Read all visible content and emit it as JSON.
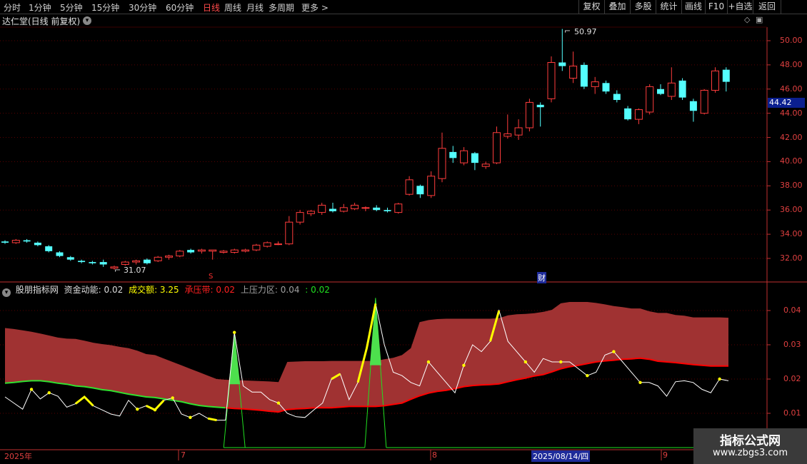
{
  "toolbar": {
    "left_items": [
      "分时",
      "1分钟",
      "5分钟",
      "15分钟",
      "30分钟",
      "60分钟",
      "日线",
      "周线",
      "月线",
      "多周期",
      "更多"
    ],
    "active_item": "日线",
    "right_items": [
      "复权",
      "叠加",
      "多股",
      "统计",
      "画线",
      "F10",
      "+自选",
      "返回"
    ],
    "more_arrow": ">"
  },
  "chart_header": {
    "title": "达仁堂(日线 前复权)"
  },
  "price_axis": {
    "ticks": [
      "50.00",
      "48.00",
      "46.00",
      "44.00",
      "42.00",
      "40.00",
      "38.00",
      "36.00",
      "34.00",
      "32.00"
    ],
    "current_price": "44.42"
  },
  "annotations": {
    "high_label": "50.97",
    "low_label": "31.07",
    "event_s": "S",
    "event_cai": "财"
  },
  "indicator": {
    "name": "股朋指标网",
    "fields": [
      {
        "label": "资金动能: 0.02",
        "color": "#dcdcdc"
      },
      {
        "label": "成交额: 3.25",
        "color": "#ffff00"
      },
      {
        "label": "承压带: 0.02",
        "color": "#ff2020"
      },
      {
        "label": "上压力区: 0.04",
        "color": "#a0a0a0"
      },
      {
        "label": ": 0.02",
        "color": "#20e020"
      }
    ],
    "axis_ticks": [
      "0.04",
      "0.03",
      "0.02",
      "0.01"
    ]
  },
  "date_axis": {
    "labels": [
      "2025年",
      "7",
      "8",
      "9"
    ],
    "cursor_date": "2025/08/14/四"
  },
  "watermark": {
    "title": "指标公式网",
    "url": "www.zbgs3.com"
  },
  "colors": {
    "up": "#ff3c3c",
    "down": "#54ffff",
    "band": "#a03232",
    "support": "#ff0000",
    "momentum": "#ffffff",
    "volume": "#ffff00",
    "green": "#20e020"
  },
  "chart_data": [
    {
      "type": "candlestick",
      "title": "达仁堂(日线 前复权)",
      "ylim": [
        31,
        51
      ],
      "candles": [
        [
          33.4,
          33.5,
          33.2,
          33.3
        ],
        [
          33.3,
          33.6,
          33.2,
          33.5
        ],
        [
          33.5,
          33.6,
          33.3,
          33.4
        ],
        [
          33.3,
          33.4,
          33.0,
          33.1
        ],
        [
          33.0,
          33.1,
          32.5,
          32.6
        ],
        [
          32.5,
          32.6,
          32.1,
          32.2
        ],
        [
          32.1,
          32.2,
          31.8,
          31.9
        ],
        [
          31.8,
          31.9,
          31.6,
          31.7
        ],
        [
          31.7,
          31.8,
          31.5,
          31.6
        ],
        [
          31.7,
          31.9,
          31.3,
          31.5
        ],
        [
          31.2,
          31.4,
          31.07,
          31.3
        ],
        [
          31.5,
          31.8,
          31.4,
          31.7
        ],
        [
          31.7,
          31.9,
          31.5,
          31.8
        ],
        [
          31.9,
          32.0,
          31.5,
          31.6
        ],
        [
          31.8,
          32.2,
          31.7,
          32.1
        ],
        [
          32.1,
          32.3,
          31.9,
          32.2
        ],
        [
          32.2,
          32.7,
          32.1,
          32.6
        ],
        [
          32.7,
          32.8,
          32.4,
          32.5
        ],
        [
          32.6,
          32.8,
          32.4,
          32.7
        ],
        [
          32.6,
          32.7,
          31.9,
          32.7
        ],
        [
          32.5,
          32.7,
          32.4,
          32.6
        ],
        [
          32.5,
          32.8,
          32.4,
          32.7
        ],
        [
          32.6,
          32.8,
          32.5,
          32.7
        ],
        [
          32.7,
          33.2,
          32.6,
          33.1
        ],
        [
          33.0,
          33.4,
          32.9,
          33.3
        ],
        [
          33.2,
          33.4,
          33.1,
          33.2
        ],
        [
          33.2,
          35.5,
          33.1,
          35.0
        ],
        [
          35.0,
          36.0,
          34.8,
          35.8
        ],
        [
          35.7,
          36.0,
          35.5,
          35.9
        ],
        [
          35.8,
          36.6,
          35.6,
          36.4
        ],
        [
          36.1,
          36.6,
          35.8,
          35.9
        ],
        [
          35.9,
          36.5,
          35.8,
          36.2
        ],
        [
          36.1,
          36.6,
          36.0,
          36.4
        ],
        [
          36.2,
          36.3,
          35.9,
          36.2
        ],
        [
          36.2,
          36.4,
          35.9,
          36.0
        ],
        [
          36.0,
          36.2,
          35.8,
          35.9
        ],
        [
          35.8,
          36.6,
          35.7,
          36.5
        ],
        [
          37.3,
          38.8,
          37.2,
          38.5
        ],
        [
          38.0,
          38.1,
          37.0,
          37.3
        ],
        [
          37.2,
          39.2,
          37.0,
          38.8
        ],
        [
          38.6,
          42.4,
          38.3,
          41.1
        ],
        [
          40.8,
          41.3,
          39.9,
          40.3
        ],
        [
          39.9,
          41.2,
          39.7,
          40.9
        ],
        [
          40.7,
          40.8,
          39.3,
          39.9
        ],
        [
          39.6,
          40.0,
          39.4,
          39.8
        ],
        [
          39.9,
          42.9,
          39.8,
          42.4
        ],
        [
          42.1,
          43.9,
          41.9,
          42.3
        ],
        [
          42.2,
          43.5,
          41.8,
          42.8
        ],
        [
          42.8,
          45.2,
          42.5,
          44.9
        ],
        [
          44.7,
          44.9,
          42.9,
          44.5
        ],
        [
          45.2,
          48.7,
          44.9,
          48.2
        ],
        [
          48.2,
          50.97,
          47.5,
          47.9
        ],
        [
          46.9,
          49.1,
          46.5,
          47.9
        ],
        [
          48.0,
          48.2,
          46.0,
          46.2
        ],
        [
          46.2,
          47.0,
          45.6,
          46.6
        ],
        [
          46.5,
          46.7,
          45.6,
          45.8
        ],
        [
          45.6,
          45.9,
          44.9,
          45.1
        ],
        [
          44.4,
          44.6,
          43.4,
          43.5
        ],
        [
          43.5,
          44.4,
          43.1,
          44.3
        ],
        [
          44.1,
          46.4,
          43.9,
          46.2
        ],
        [
          46.0,
          46.4,
          45.5,
          45.6
        ],
        [
          45.4,
          47.8,
          45.1,
          46.5
        ],
        [
          46.7,
          46.9,
          45.1,
          45.3
        ],
        [
          45.0,
          45.2,
          43.3,
          44.2
        ],
        [
          44.0,
          46.0,
          43.9,
          45.9
        ],
        [
          45.9,
          47.8,
          45.7,
          47.5
        ],
        [
          47.6,
          47.8,
          45.8,
          46.6
        ]
      ]
    },
    {
      "type": "line",
      "title": "股朋指标网",
      "ylim": [
        0,
        0.047
      ],
      "series": [
        {
          "name": "上压力区",
          "values": [
            0.0349,
            0.0346,
            0.0342,
            0.0338,
            0.0333,
            0.0327,
            0.0321,
            0.0318,
            0.0317,
            0.0312,
            0.0306,
            0.0302,
            0.0299,
            0.0294,
            0.029,
            0.0283,
            0.0273,
            0.027,
            0.026,
            0.025,
            0.024,
            0.023,
            0.022,
            0.021,
            0.02,
            0.0198,
            0.0197,
            0.0196,
            0.0195,
            0.0194,
            0.0193,
            0.0191,
            0.025,
            0.0251,
            0.0252,
            0.0252,
            0.0252,
            0.0253,
            0.0253,
            0.0253,
            0.0253,
            0.0253,
            0.0253,
            0.0258,
            0.0262,
            0.027,
            0.029,
            0.0366,
            0.0372,
            0.0375,
            0.0376,
            0.0376,
            0.0376,
            0.0376,
            0.0376,
            0.0376,
            0.0378,
            0.0386,
            0.0389,
            0.039,
            0.0392,
            0.0396,
            0.0402,
            0.0421,
            0.0425,
            0.0425,
            0.0425,
            0.0422,
            0.0418,
            0.0413,
            0.041,
            0.0406,
            0.0406,
            0.0398,
            0.0393,
            0.0393,
            0.0387,
            0.0385,
            0.038,
            0.038,
            0.038,
            0.038,
            0.0379
          ]
        },
        {
          "name": "承压带",
          "values": [
            0.0188,
            0.019,
            0.0193,
            0.0195,
            0.0195,
            0.0192,
            0.0188,
            0.0185,
            0.018,
            0.0178,
            0.0174,
            0.0169,
            0.0166,
            0.0161,
            0.0156,
            0.0152,
            0.0148,
            0.0146,
            0.0142,
            0.0138,
            0.0134,
            0.0128,
            0.0123,
            0.012,
            0.0118,
            0.0116,
            0.0114,
            0.0113,
            0.0111,
            0.0109,
            0.0106,
            0.0104,
            0.0111,
            0.0113,
            0.0114,
            0.0116,
            0.0116,
            0.0116,
            0.0118,
            0.012,
            0.012,
            0.012,
            0.012,
            0.0122,
            0.0126,
            0.013,
            0.0141,
            0.0151,
            0.0159,
            0.0164,
            0.0167,
            0.0172,
            0.0178,
            0.0181,
            0.0183,
            0.0184,
            0.0186,
            0.0192,
            0.0198,
            0.0203,
            0.0209,
            0.0213,
            0.0221,
            0.023,
            0.0236,
            0.024,
            0.0245,
            0.025,
            0.0253,
            0.0255,
            0.0258,
            0.0259,
            0.0261,
            0.0258,
            0.0252,
            0.025,
            0.0248,
            0.0245,
            0.0242,
            0.024,
            0.0238,
            0.0238,
            0.0238
          ]
        },
        {
          "name": "资金动能",
          "values": [
            0.0148,
            0.013,
            0.0112,
            0.017,
            0.0142,
            0.016,
            0.015,
            0.0118,
            0.0128,
            0.0148,
            0.0122,
            0.011,
            0.0098,
            0.0092,
            0.0138,
            0.0112,
            0.0122,
            0.011,
            0.0138,
            0.0145,
            0.0098,
            0.0088,
            0.01,
            0.0085,
            0.008,
            0.008,
            0.0336,
            0.018,
            0.0162,
            0.0162,
            0.014,
            0.013,
            0.01,
            0.009,
            0.0088,
            0.011,
            0.013,
            0.02,
            0.0215,
            0.014,
            0.019,
            0.029,
            0.042,
            0.03,
            0.022,
            0.021,
            0.019,
            0.018,
            0.025,
            0.022,
            0.019,
            0.016,
            0.024,
            0.03,
            0.028,
            0.031,
            0.04,
            0.031,
            0.028,
            0.025,
            0.022,
            0.026,
            0.025,
            0.025,
            0.025,
            0.023,
            0.021,
            0.022,
            0.027,
            0.028,
            0.025,
            0.022,
            0.019,
            0.019,
            0.018,
            0.015,
            0.0192,
            0.0195,
            0.019,
            0.017,
            0.016,
            0.02,
            0.0195
          ]
        },
        {
          "name": "成交额",
          "values": [
            0.0,
            0.0,
            0.0,
            0.0,
            0.0,
            0.0,
            0.0,
            0.0,
            0.0,
            0.0,
            0.0,
            0.0,
            0.0,
            0.0,
            0.0,
            0.0,
            0.0,
            0.0,
            0.0,
            0.0,
            0.0,
            0.0,
            0.0,
            0.0,
            0.0,
            0.0,
            0.0336,
            0.0,
            0.0,
            0.0,
            0.0,
            0.0,
            0.0,
            0.0,
            0.0,
            0.0,
            0.0,
            0.0,
            0.0,
            0.0,
            0.0,
            0.0,
            0.0437,
            0.0,
            0.0,
            0.0,
            0.0,
            0.0,
            0.0,
            0.0,
            0.0,
            0.0,
            0.0,
            0.0,
            0.0,
            0.0,
            0.0,
            0.0,
            0.0,
            0.0,
            0.0,
            0.0,
            0.0,
            0.0,
            0.0,
            0.0,
            0.0,
            0.0,
            0.0,
            0.0,
            0.0,
            0.0,
            0.0,
            0.0,
            0.0,
            0.0,
            0.0,
            0.0,
            0.0,
            0.0,
            0.0,
            0.0,
            0.0
          ]
        }
      ]
    }
  ]
}
